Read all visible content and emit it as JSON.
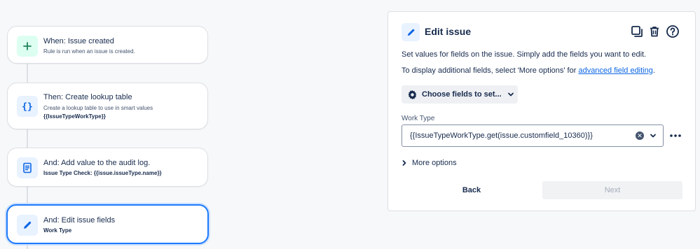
{
  "rules": [
    {
      "title": "When: Issue created",
      "subtitle": "Rule is run when an issue is created.",
      "subtitle2": "",
      "icon": "plus-icon"
    },
    {
      "title": "Then: Create lookup table",
      "subtitle": "Create a lookup table to use in smart values",
      "subtitle2": "{{IssueTypeWorkType}}",
      "icon": "braces-icon"
    },
    {
      "title": "And: Add value to the audit log.",
      "subtitle": "Issue Type Check: {{issue.issueType.name}}",
      "subtitle2": "",
      "icon": "document-icon"
    },
    {
      "title": "And: Edit issue fields",
      "subtitle": "Work Type",
      "subtitle2": "",
      "icon": "pencil-icon"
    }
  ],
  "panel": {
    "title": "Edit issue",
    "desc1": "Set values for fields on the issue. Simply add the fields you want to edit.",
    "desc2_prefix": "To display additional fields, select 'More options' for ",
    "desc2_link": "advanced field editing",
    "desc2_suffix": ".",
    "choose_fields_label": "Choose fields to set...",
    "field_label": "Work Type",
    "field_value": "{{IssueTypeWorkType.get(issue.customfield_10360)}}",
    "more_options_label": "More options",
    "back_label": "Back",
    "next_label": "Next"
  },
  "colors": {
    "accent": "#1d7afc",
    "link": "#0c66e4",
    "trigger_icon_bg": "#dcfff1",
    "action_icon_bg": "#e9f2ff"
  }
}
